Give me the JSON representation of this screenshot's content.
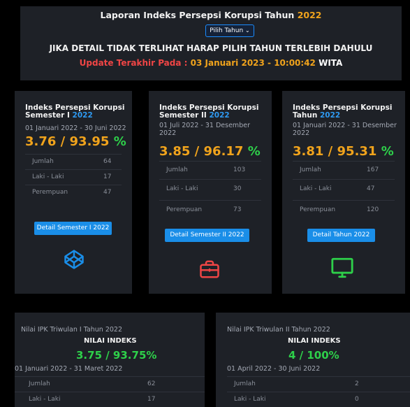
{
  "header": {
    "title_prefix": "Laporan Indeks Persepsi Korupsi Tahun",
    "title_year": "2022",
    "year_select": "Pilih Tahun",
    "warning": "JIKA DETAIL TIDAK TERLIHAT HARAP PILIH TAHUN TERLEBIH DAHULU",
    "update_label": "Update Terakhir Pada :",
    "update_datetime": "03 Januari 2023 - 10:00:42",
    "update_tz": "WITA"
  },
  "cards": [
    {
      "title": "Indeks Persepsi Korupsi Semester I",
      "year": "2022",
      "range": "01 Januari 2022 - 30 Juni 2022",
      "value": "3.76 / 93.95",
      "pct": "%",
      "stats": [
        {
          "label": "Jumlah",
          "value": "64"
        },
        {
          "label": "Laki - Laki",
          "value": "17"
        },
        {
          "label": "Perempuan",
          "value": "47"
        }
      ],
      "button": "Detail Semester I 2022",
      "icon": "codepen-icon"
    },
    {
      "title": "Indeks Persepsi Korupsi Semester II",
      "year": "2022",
      "range": "01 Juli 2022 - 31 Desember 2022",
      "value": "3.85 / 96.17",
      "pct": "%",
      "stats": [
        {
          "label": "Jumlah",
          "value": "103"
        },
        {
          "label": "Laki - Laki",
          "value": "30"
        },
        {
          "label": "Perempuan",
          "value": "73"
        }
      ],
      "button": "Detail Semester II 2022",
      "icon": "briefcase-icon"
    },
    {
      "title": "Indeks Persepsi Korupsi Tahun",
      "year": "2022",
      "range": "01 Januari 2022 - 31 Desember 2022",
      "value": "3.81 / 95.31",
      "pct": "%",
      "stats": [
        {
          "label": "Jumlah",
          "value": "167"
        },
        {
          "label": "Laki - Laki",
          "value": "47"
        },
        {
          "label": "Perempuan",
          "value": "120"
        }
      ],
      "button": "Detail Tahun 2022",
      "icon": "monitor-icon"
    }
  ],
  "triwulan": [
    {
      "title": "Nilai IPK Triwulan I Tahun 2022",
      "nilai_label": "NILAI INDEKS",
      "value": "3.75 / 93.75%",
      "range": "01 Januari 2022 - 31 Maret 2022",
      "stats": [
        {
          "label": "Jumlah",
          "value": "62"
        },
        {
          "label": "Laki - Laki",
          "value": "17"
        }
      ]
    },
    {
      "title": "Nilai IPK Triwulan II Tahun 2022",
      "nilai_label": "NILAI INDEKS",
      "value": "4 / 100%",
      "range": "01 April 2022 - 30 Juni 2022",
      "stats": [
        {
          "label": "Jumlah",
          "value": "2"
        },
        {
          "label": "Laki - Laki",
          "value": "0"
        }
      ]
    }
  ],
  "colors": {
    "accent_orange": "#f0a31c",
    "accent_green": "#2ed04a",
    "accent_blue": "#1a8ee8",
    "accent_red": "#ef4545",
    "card_bg": "#1e2127"
  }
}
